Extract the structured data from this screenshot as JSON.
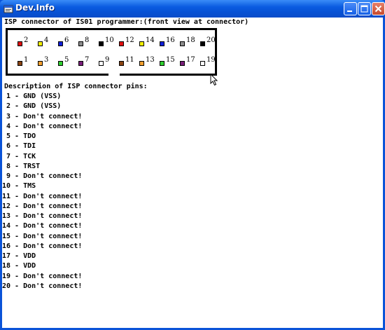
{
  "window": {
    "title": "Dev.Info",
    "icon": "window-app-icon",
    "controls": [
      "minimize",
      "maximize",
      "close"
    ]
  },
  "heading": "ISP connector of IS01 programmer:(front view at connector)",
  "connector": {
    "top_row": [
      {
        "num": "2",
        "color": "#e01010"
      },
      {
        "num": "4",
        "color": "#f4f000"
      },
      {
        "num": "6",
        "color": "#1020d8"
      },
      {
        "num": "8",
        "color": "#8c8c8c"
      },
      {
        "num": "10",
        "color": "#000000"
      },
      {
        "num": "12",
        "color": "#e01010"
      },
      {
        "num": "14",
        "color": "#f4f000"
      },
      {
        "num": "16",
        "color": "#1020d8"
      },
      {
        "num": "18",
        "color": "#8c8c8c"
      },
      {
        "num": "20",
        "color": "#000000"
      }
    ],
    "bottom_row": [
      {
        "num": "1",
        "color": "#8b4513"
      },
      {
        "num": "3",
        "color": "#f4a030"
      },
      {
        "num": "5",
        "color": "#30d030"
      },
      {
        "num": "7",
        "color": "#7a1f7a"
      },
      {
        "num": "9",
        "color": "#ffffff"
      },
      {
        "num": "11",
        "color": "#8b4513"
      },
      {
        "num": "13",
        "color": "#f4a030"
      },
      {
        "num": "15",
        "color": "#30d030"
      },
      {
        "num": "17",
        "color": "#7a1f7a"
      },
      {
        "num": "19",
        "color": "#ffffff"
      }
    ]
  },
  "description_heading": "Description of ISP connector pins:",
  "pins": [
    " 1 - GND (VSS)",
    " 2 - GND (VSS)",
    " 3 - Don't connect!",
    " 4 - Don't connect!",
    " 5 - TDO",
    " 6 - TDI",
    " 7 - TCK",
    " 8 - TRST",
    " 9 - Don't connect!",
    "10 - TMS",
    "11 - Don't connect!",
    "12 - Don't connect!",
    "13 - Don't connect!",
    "14 - Don't connect!",
    "15 - Don't connect!",
    "16 - Don't connect!",
    "17 - VDD",
    "18 - VDD",
    "19 - Don't connect!",
    "20 - Don't connect!"
  ]
}
